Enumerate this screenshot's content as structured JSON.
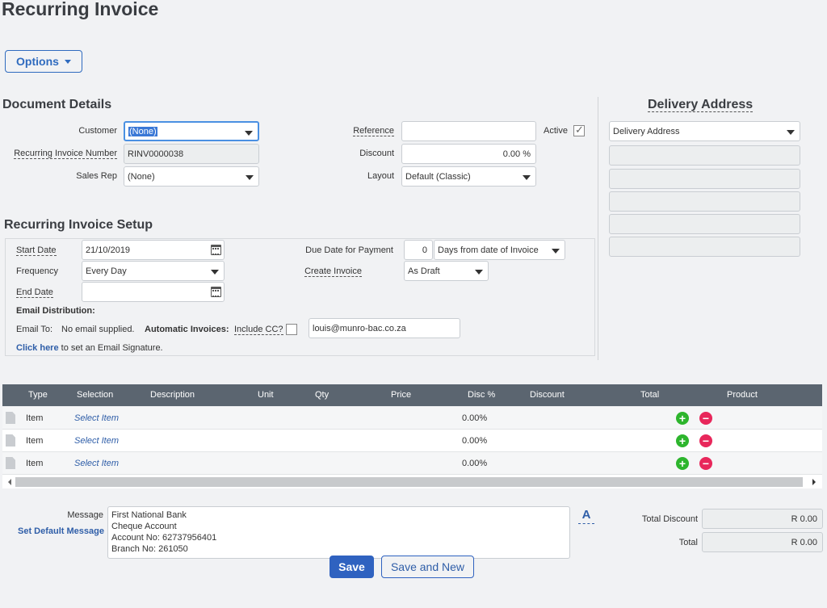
{
  "page": {
    "title": "Recurring Invoice"
  },
  "toolbar": {
    "options_label": "Options"
  },
  "document_details": {
    "title": "Document Details",
    "customer_label": "Customer",
    "customer_value": "(None)",
    "recurring_number_label": "Recurring Invoice Number",
    "recurring_number_value": "RINV0000038",
    "sales_rep_label": "Sales Rep",
    "sales_rep_value": "(None)",
    "reference_label": "Reference",
    "reference_value": "",
    "active_label": "Active",
    "active_checked": true,
    "discount_label": "Discount",
    "discount_value": "0.00 %",
    "layout_label": "Layout",
    "layout_value": "Default (Classic)"
  },
  "delivery_address": {
    "title": "Delivery Address",
    "select_value": "Delivery Address",
    "lines": [
      "",
      "",
      "",
      "",
      ""
    ]
  },
  "setup": {
    "title": "Recurring Invoice Setup",
    "start_date_label": "Start Date",
    "start_date_value": "21/10/2019",
    "frequency_label": "Frequency",
    "frequency_value": "Every Day",
    "end_date_label": "End Date",
    "end_date_value": "",
    "due_date_label": "Due Date for Payment",
    "due_days_value": "0",
    "due_type_value": "Days from date of Invoice",
    "create_invoice_label": "Create Invoice",
    "create_invoice_value": "As Draft",
    "email_distribution_label": "Email Distribution:",
    "email_to_label": "Email To:",
    "email_to_value": "No email supplied.",
    "automatic_invoices_label": "Automatic Invoices:",
    "include_cc_label": "Include CC?",
    "cc_email_value": "louis@munro-bac.co.za",
    "click_here_label": "Click here",
    "signature_text": "to set an Email Signature."
  },
  "grid": {
    "columns": [
      "Type",
      "Selection",
      "Description",
      "Unit",
      "Qty",
      "Price",
      "Disc %",
      "Discount",
      "Total",
      "Product"
    ],
    "rows": [
      {
        "type": "Item",
        "selection": "Select Item",
        "disc": "0.00%"
      },
      {
        "type": "Item",
        "selection": "Select Item",
        "disc": "0.00%"
      },
      {
        "type": "Item",
        "selection": "Select Item",
        "disc": "0.00%"
      }
    ]
  },
  "footer": {
    "message_label": "Message",
    "set_default_label": "Set Default Message",
    "message_lines": [
      "First National Bank",
      "Cheque Account",
      "Account No: 62737956401",
      "Branch No: 261050"
    ],
    "font_button_label": "A",
    "total_discount_label": "Total Discount",
    "total_discount_value": "R 0.00",
    "total_label": "Total",
    "total_value": "R 0.00",
    "save_label": "Save",
    "save_new_label": "Save and New"
  }
}
